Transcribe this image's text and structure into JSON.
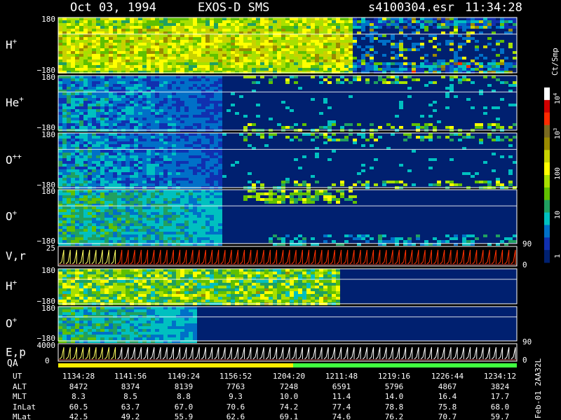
{
  "header": {
    "date": "Oct 03, 1994",
    "instrument": "EXOS-D SMS",
    "file": "s4100304.esr",
    "time": "11:34:28"
  },
  "panels": [
    {
      "label": "H",
      "sup": "+",
      "ytop": "180",
      "ybot": "−180",
      "style": "hplus"
    },
    {
      "label": "He",
      "sup": "+",
      "ytop": "180",
      "ybot": "−180",
      "style": "weak"
    },
    {
      "label": "O",
      "sup": "++",
      "ytop": "180",
      "ybot": "−180",
      "style": "weak"
    },
    {
      "label": "O",
      "sup": "+",
      "ytop": "180",
      "ybot": "−180",
      "style": "oplus"
    },
    {
      "label": "V,r",
      "sup": "",
      "ytop": "25",
      "ybot": "",
      "style": "sweep"
    },
    {
      "label": "H",
      "sup": "+",
      "ytop": "180",
      "ybot": "−180",
      "style": "hplus2"
    },
    {
      "label": "O",
      "sup": "+",
      "ytop": "180",
      "ybot": "−180",
      "style": "oplus2"
    },
    {
      "label": "E,p",
      "sup": "",
      "ytop": "4000",
      "ybot": "",
      "style": "ep"
    }
  ],
  "right_labels": {
    "sweep_90": "90",
    "sweep_0": "0",
    "oplus2_90": "90",
    "ep_0": "0"
  },
  "qa_label": "QA",
  "zero_label": "0",
  "colorbar": {
    "unit": "Ct/Smp",
    "ticks": [
      "10",
      "100",
      "10",
      "1"
    ],
    "tick_exp": {
      "top": "4",
      "mid": "3"
    },
    "colors": [
      "#ffffff",
      "#d00000",
      "#ff2a00",
      "#7a6a20",
      "#9a8a00",
      "#c8d200",
      "#ffff00",
      "#a8e000",
      "#60c000",
      "#20a060",
      "#00c0c0",
      "#0070c8",
      "#1030b0",
      "#002070"
    ]
  },
  "side_stamp": "Feb-01 2AA32L",
  "footer": {
    "row_labels": [
      "UT",
      "ALT",
      "MLT",
      "InLat",
      "MLat"
    ],
    "columns": [
      [
        "1134:28",
        "8472",
        "8.3",
        "60.5",
        "42.5"
      ],
      [
        "1141:56",
        "8374",
        "8.5",
        "63.7",
        "49.2"
      ],
      [
        "1149:24",
        "8139",
        "8.8",
        "67.0",
        "55.9"
      ],
      [
        "1156:52",
        "7763",
        "9.3",
        "70.6",
        "62.6"
      ],
      [
        "1204:20",
        "7248",
        "10.0",
        "74.2",
        "69.1"
      ],
      [
        "1211:48",
        "6591",
        "11.4",
        "77.4",
        "74.6"
      ],
      [
        "1219:16",
        "5796",
        "14.0",
        "78.8",
        "76.2"
      ],
      [
        "1226:44",
        "4867",
        "16.4",
        "75.8",
        "70.7"
      ],
      [
        "1234:12",
        "3824",
        "17.7",
        "68.0",
        "59.7"
      ]
    ]
  },
  "chart_data": {
    "type": "heatmap",
    "title": "Oct 03, 1994   EXOS-D SMS",
    "x": [
      "1134:28",
      "1141:56",
      "1149:24",
      "1156:52",
      "1204:20",
      "1211:48",
      "1219:16",
      "1226:44",
      "1234:12"
    ],
    "series": [
      {
        "name": "H+",
        "ylim": [
          -180,
          180
        ]
      },
      {
        "name": "He+",
        "ylim": [
          -180,
          180
        ]
      },
      {
        "name": "O++",
        "ylim": [
          -180,
          180
        ]
      },
      {
        "name": "O+",
        "ylim": [
          -180,
          180
        ]
      },
      {
        "name": "V,r",
        "ylim": [
          0,
          25
        ]
      },
      {
        "name": "H+",
        "ylim": [
          -180,
          180
        ]
      },
      {
        "name": "O+",
        "ylim": [
          -180,
          180
        ]
      },
      {
        "name": "E,p",
        "ylim": [
          0,
          4000
        ]
      }
    ],
    "color_scale": "log",
    "color_range": [
      1,
      10000
    ],
    "color_unit": "Ct/Smp"
  }
}
